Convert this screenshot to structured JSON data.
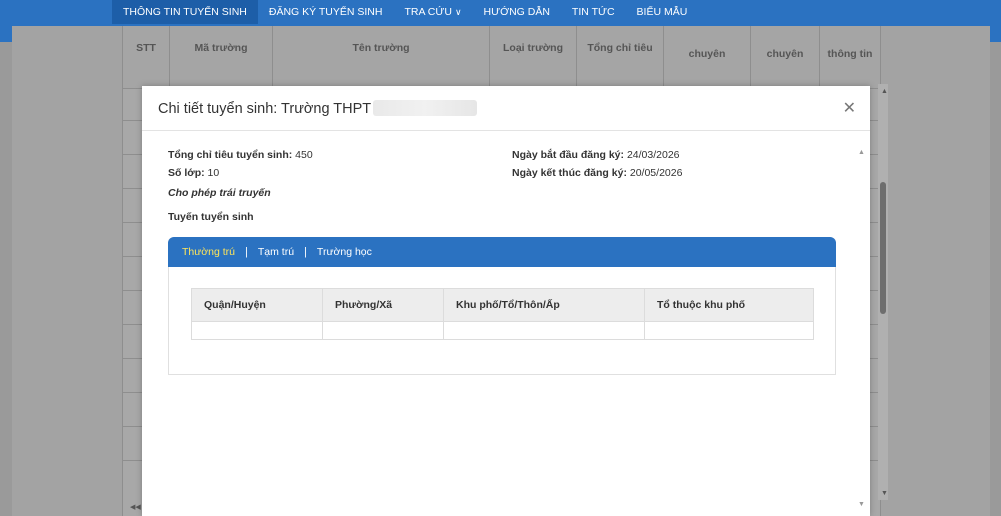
{
  "nav": {
    "items": [
      {
        "label": "THÔNG TIN TUYỂN SINH",
        "active": true
      },
      {
        "label": "ĐĂNG KÝ TUYỂN SINH",
        "active": false
      },
      {
        "label": "TRA CỨU",
        "active": false,
        "has_dropdown": true
      },
      {
        "label": "HƯỚNG DẪN",
        "active": false
      },
      {
        "label": "TIN TỨC",
        "active": false
      },
      {
        "label": "BIỂU MẪU",
        "active": false
      }
    ]
  },
  "background_table": {
    "headers": [
      "STT",
      "Mã trường",
      "Tên trường",
      "Loại trường",
      "Tổng chỉ tiêu",
      "chuyên",
      "chuyên",
      "thông tin"
    ]
  },
  "modal": {
    "title": "Chi tiết tuyển sinh: Trường THPT",
    "close_icon": "close-icon",
    "fields": {
      "total_quota_label": "Tổng chỉ tiêu tuyển sinh:",
      "total_quota_value": " 450",
      "class_count_label": "Số lớp:",
      "class_count_value": " 10",
      "start_date_label": "Ngày bắt đầu đăng ký:",
      "start_date_value": " 24/03/2026",
      "end_date_label": "Ngày kết thúc đăng ký:",
      "end_date_value": " 20/05/2026"
    },
    "note": "Cho phép trái truyến",
    "section_title": "Tuyến tuyển sinh",
    "tabs": [
      {
        "label": "Thường trú",
        "active": true
      },
      {
        "label": "Tạm trú",
        "active": false
      },
      {
        "label": "Trường học",
        "active": false
      }
    ],
    "table": {
      "columns": [
        "Quận/Huyện",
        "Phường/Xã",
        "Khu phố/Tổ/Thôn/Ấp",
        "Tổ thuộc khu phố"
      ]
    }
  },
  "colors": {
    "primary": "#2b72c1",
    "active_tab": "#ffe55a"
  }
}
